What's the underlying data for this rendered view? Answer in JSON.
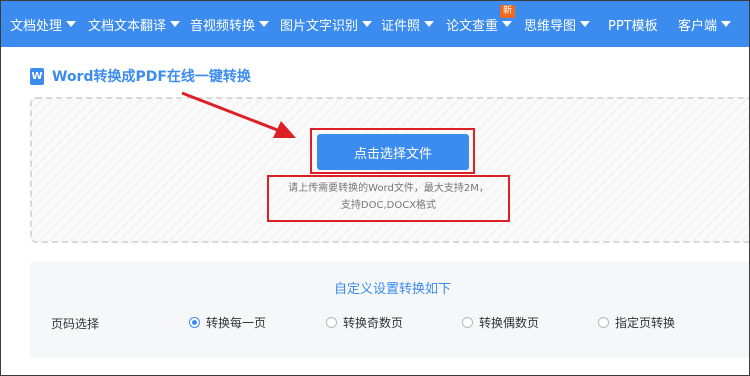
{
  "nav": {
    "items": [
      {
        "label": "文档处理",
        "dropdown": true
      },
      {
        "label": "文档文本翻译",
        "dropdown": true
      },
      {
        "label": "音视频转换",
        "dropdown": true
      },
      {
        "label": "图片文字识别",
        "dropdown": true
      },
      {
        "label": "证件照",
        "dropdown": true
      },
      {
        "label": "论文查重",
        "dropdown": true,
        "badge": "新"
      },
      {
        "label": "思维导图",
        "dropdown": true
      },
      {
        "label": "PPT模板",
        "dropdown": false
      },
      {
        "label": "客户端",
        "dropdown": true
      }
    ],
    "background": "#3c8cf0"
  },
  "page": {
    "icon_letter": "W",
    "title": "Word转换成PDF在线一键转换"
  },
  "upload": {
    "button_label": "点击选择文件",
    "hint_line1": "请上传需要转换的Word文件，最大支持2M，",
    "hint_line2": "支持DOC,DOCX格式"
  },
  "settings": {
    "title": "自定义设置转换如下",
    "page_select_label": "页码选择",
    "options": [
      {
        "label": "转换每一页",
        "checked": true
      },
      {
        "label": "转换奇数页",
        "checked": false
      },
      {
        "label": "转换偶数页",
        "checked": false
      },
      {
        "label": "指定页转换",
        "checked": false
      }
    ]
  },
  "colors": {
    "accent": "#3c8cf0",
    "annotation": "#dd1f26",
    "badge": "#f06a1e"
  }
}
